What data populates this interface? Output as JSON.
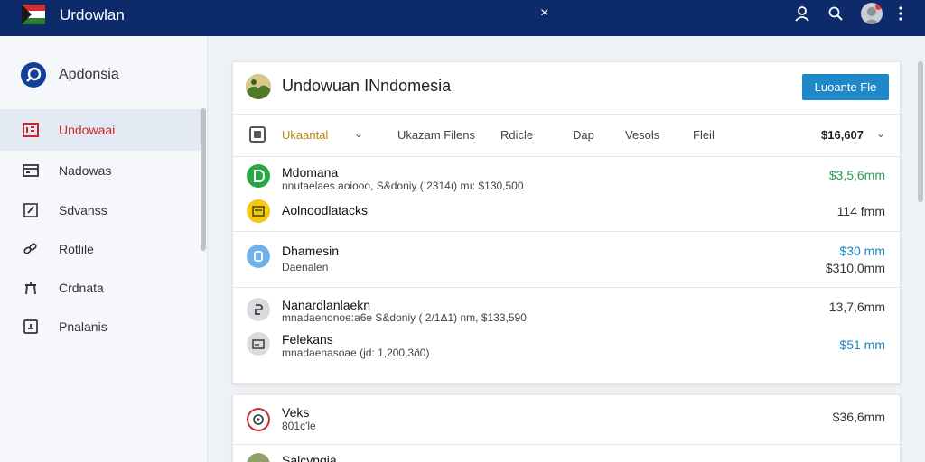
{
  "topbar": {
    "title": "Urdowlan",
    "close_glyph": "×",
    "icons": [
      "user-icon",
      "search-icon",
      "avatar",
      "more-icon"
    ]
  },
  "sidebar": {
    "brand": "Apdonsia",
    "items": [
      {
        "label": "Undowaai",
        "icon": "inbox-icon",
        "active": true
      },
      {
        "label": "Nadowas",
        "icon": "window-icon",
        "active": false
      },
      {
        "label": "Sdvanss",
        "icon": "edit-icon",
        "active": false
      },
      {
        "label": "Rotlile",
        "icon": "link-icon",
        "active": false
      },
      {
        "label": "Crdnata",
        "icon": "pin-icon",
        "active": false
      },
      {
        "label": "Pnalanis",
        "icon": "document-icon",
        "active": false
      }
    ]
  },
  "card": {
    "title": "Undowuan INndomesia",
    "upload_label": "Luoante Fle",
    "filter": {
      "selected": "Ukaantal",
      "columns": [
        "Ukazam Filens",
        "Rdicle",
        "Dap",
        "Vesols",
        "Fleil"
      ],
      "total": "$16,607"
    },
    "rows": [
      {
        "name": "Mdomana",
        "sub": "nnutaelaes aoiooo, S&doniy (.2314ı) mı: $130,500",
        "amount": "$3,5,6mm",
        "tone": "green",
        "icon": "green-d-icon"
      },
      {
        "name": "Aolnoodlatacks",
        "sub": "",
        "amount": "114 fmm",
        "tone": "dark",
        "icon": "yellow-box-icon"
      },
      {
        "name": "Dhamesin",
        "sub": "Daenalen",
        "amount": "$30 mm",
        "amount2": "$310,0mm",
        "tone": "blue",
        "icon": "blue-circle-icon"
      },
      {
        "name": "Nanardlanlaekn",
        "sub": "mnadaenonoe:a6e S&doniy ( 2/1Δ1) nm, $133,590",
        "amount": "13,7,6mm",
        "tone": "dark",
        "icon": "gray-b-icon"
      },
      {
        "name": "Felekans",
        "sub": "mnadaenasoae (jd: 1,200,3ð0)",
        "amount": "$51 mm",
        "tone": "blue",
        "icon": "gray-screen-icon"
      }
    ]
  },
  "card2": {
    "rows": [
      {
        "name": "Veks",
        "sub": "801c'le",
        "amount": "$36,6mm",
        "icon": "red-target-icon"
      },
      {
        "name": "Salcyngia",
        "sub": "",
        "amount": "",
        "icon": "photo-icon"
      }
    ]
  },
  "colors": {
    "topbar": "#0d2a6b",
    "accent": "#1e88c9",
    "active_nav": "#c62828",
    "positive": "#2e9c57"
  }
}
